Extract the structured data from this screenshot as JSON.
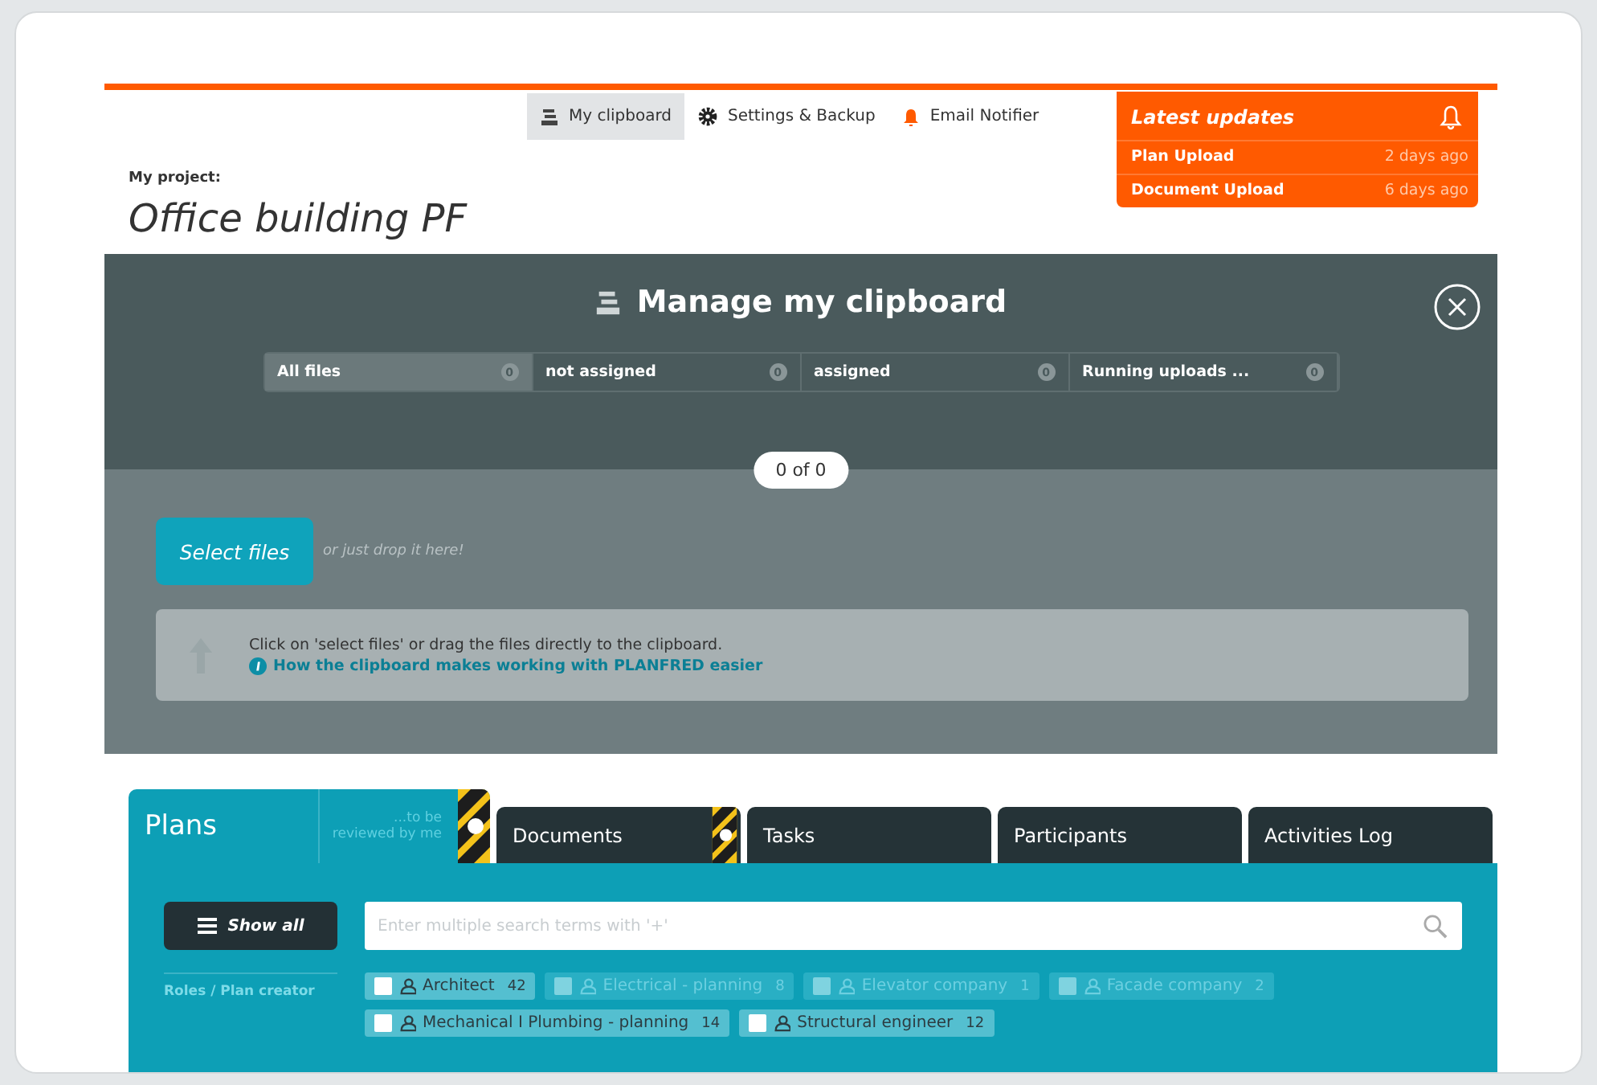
{
  "nav": [
    {
      "label": "My clipboard",
      "selected": true
    },
    {
      "label": "Settings & Backup",
      "selected": false
    },
    {
      "label": "Email Notifier",
      "selected": false
    }
  ],
  "updates": {
    "title": "Latest updates",
    "items": [
      {
        "name": "Plan Upload",
        "time": "2 days ago"
      },
      {
        "name": "Document Upload",
        "time": "6 days ago"
      }
    ]
  },
  "project": {
    "label": "My project:",
    "title": "Office building PF"
  },
  "clipboard": {
    "title": "Manage my clipboard",
    "filters": [
      {
        "label": "All files",
        "count": "0",
        "selected": true
      },
      {
        "label": "not assigned",
        "count": "0",
        "selected": false
      },
      {
        "label": "assigned",
        "count": "0",
        "selected": false
      },
      {
        "label": "Running uploads ...",
        "count": "0",
        "selected": false
      }
    ],
    "counter": "0 of 0",
    "select_button": "Select files",
    "drop_hint": "or just drop it here!",
    "info": "Click on 'select files' or drag the files directly to the clipboard.",
    "info_link": "How the clipboard makes working with PLANFRED easier"
  },
  "tabs": [
    {
      "label": "Plans",
      "sub": "...to be reviewed by me",
      "selected": true,
      "flagged": true
    },
    {
      "label": "Documents",
      "selected": false,
      "flagged": true
    },
    {
      "label": "Tasks",
      "selected": false,
      "flagged": false
    },
    {
      "label": "Participants",
      "selected": false,
      "flagged": false
    },
    {
      "label": "Activities Log",
      "selected": false,
      "flagged": false
    }
  ],
  "show_all": "Show all",
  "search": {
    "placeholder": "Enter multiple search terms with '+'"
  },
  "roles_label": "Roles / Plan creator",
  "roles": [
    {
      "name": "Architect",
      "count": "42",
      "disabled": false,
      "checked": false
    },
    {
      "name": "Electrical - planning",
      "count": "8",
      "disabled": true,
      "checked": false
    },
    {
      "name": "Elevator company",
      "count": "1",
      "disabled": true,
      "checked": false
    },
    {
      "name": "Facade company",
      "count": "2",
      "disabled": true,
      "checked": false
    },
    {
      "name": "Mechanical I Plumbing - planning",
      "count": "14",
      "disabled": false,
      "checked": false
    },
    {
      "name": "Structural engineer",
      "count": "12",
      "disabled": false,
      "checked": false
    }
  ]
}
